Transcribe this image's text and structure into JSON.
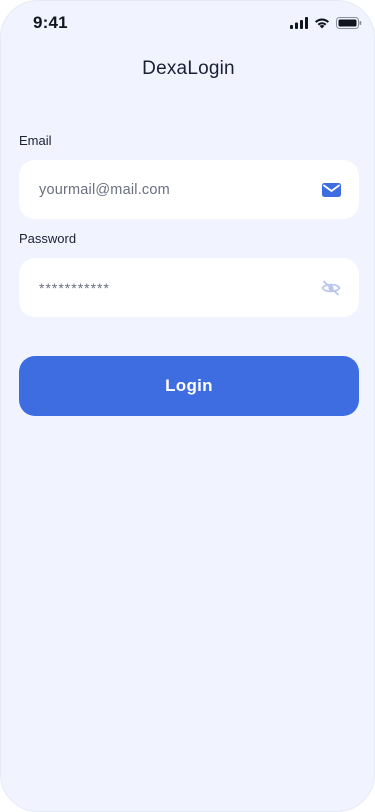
{
  "status_bar": {
    "time": "9:41",
    "icons": [
      "cellular-signal-icon",
      "wifi-icon",
      "battery-icon"
    ]
  },
  "header": {
    "title": "DexaLogin"
  },
  "form": {
    "email": {
      "label": "Email",
      "value": "yourmail@mail.com",
      "icon": "envelope-icon"
    },
    "password": {
      "label": "Password",
      "value": "***********",
      "icon": "eye-slash-icon"
    },
    "submit_label": "Login"
  },
  "colors": {
    "background": "#f1f4ff",
    "field_background": "#ffffff",
    "accent": "#3d6de0",
    "icon_muted": "#b9c6ee",
    "text_primary": "#1a1f33",
    "text_secondary": "#6a6f80"
  }
}
